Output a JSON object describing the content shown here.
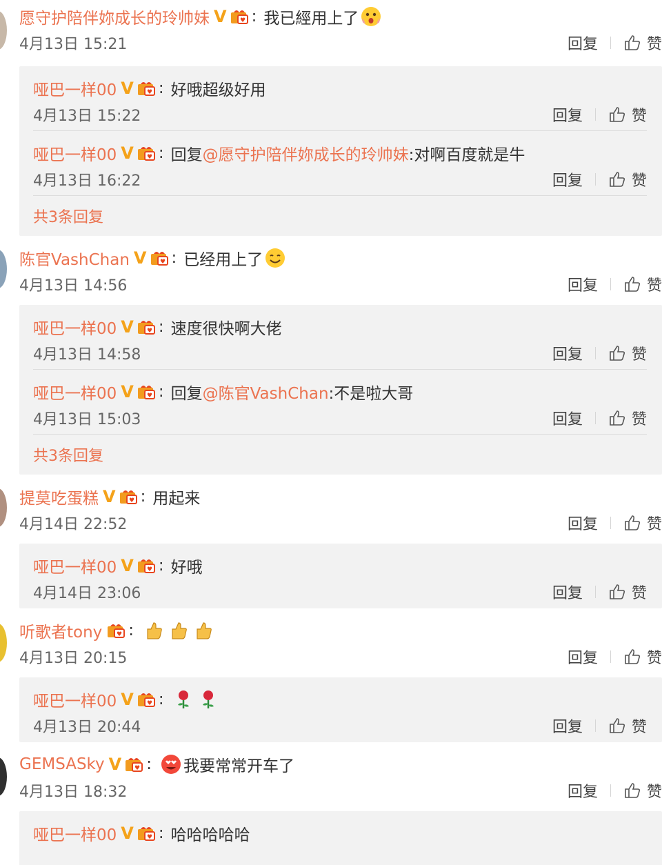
{
  "reply_label": "回复",
  "like_label": "赞",
  "threads": [
    {
      "user": "愿守护陪伴妳成长的玲帅妹",
      "verified": true,
      "text": "我已經用上了",
      "emoji": "shocked-face-emoji",
      "time": "4月13日 15:21",
      "replies": [
        {
          "user": "哑巴一样00",
          "verified": true,
          "prefix": "",
          "mention": "",
          "text": "好哦超级好用",
          "time": "4月13日 15:22"
        },
        {
          "user": "哑巴一样00",
          "verified": true,
          "prefix": "回复",
          "mention": "@愿守护陪伴妳成长的玲帅妹",
          "text": ":对啊百度就是牛",
          "time": "4月13日 16:22"
        }
      ],
      "more_label": "共3条回复"
    },
    {
      "user": "陈官VashChan",
      "verified": true,
      "text": "已经用上了",
      "emoji": "smiling-face-emoji",
      "time": "4月13日 14:56",
      "replies": [
        {
          "user": "哑巴一样00",
          "verified": true,
          "prefix": "",
          "mention": "",
          "text": "速度很快啊大佬",
          "time": "4月13日 14:58"
        },
        {
          "user": "哑巴一样00",
          "verified": true,
          "prefix": "回复",
          "mention": "@陈官VashChan",
          "text": ":不是啦大哥",
          "time": "4月13日 15:03"
        }
      ],
      "more_label": "共3条回复"
    },
    {
      "user": "提莫吃蛋糕",
      "verified": true,
      "text": "用起来",
      "time": "4月14日 22:52",
      "replies": [
        {
          "user": "哑巴一样00",
          "verified": true,
          "text": "好哦",
          "time": "4月14日 23:06"
        }
      ]
    },
    {
      "user": "听歌者tony",
      "verified": false,
      "text": "",
      "emoji": "thumbs-up-emoji x3",
      "time": "4月13日 20:15",
      "replies": [
        {
          "user": "哑巴一样00",
          "verified": true,
          "text": "",
          "emoji": "rose-emoji x2",
          "time": "4月13日 20:44"
        }
      ]
    },
    {
      "user": "GEMSASky",
      "verified": true,
      "text": "我要常常开车了",
      "emoji": "heart-eyes-emoji",
      "time": "4月13日 18:32",
      "replies": [
        {
          "user": "哑巴一样00",
          "verified": true,
          "text": "哈哈哈哈哈",
          "time": ""
        }
      ]
    }
  ],
  "colors": {
    "username": "#eb7350",
    "verified_badge": "#f4a21a",
    "reply_bg": "#f2f2f2"
  }
}
